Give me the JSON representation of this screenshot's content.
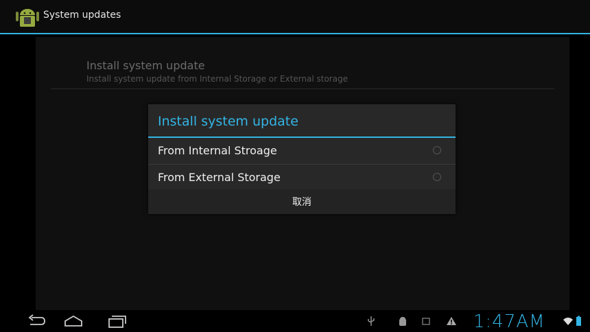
{
  "actionbar": {
    "title": "System updates",
    "icon": "android-app-icon"
  },
  "preference": {
    "title": "Install system update",
    "summary": "Install system update from Internal Storage or External storage"
  },
  "dialog": {
    "title": "Install system update",
    "options": [
      {
        "label": "From Internal Stroage",
        "selected": false
      },
      {
        "label": "From External Storage",
        "selected": false
      }
    ],
    "cancel_label": "取消"
  },
  "navbar": {
    "buttons": [
      "back-icon",
      "home-icon",
      "recent-apps-icon"
    ],
    "status_icons": [
      "usb-icon",
      "debug-icon",
      "sd-card-icon",
      "warning-icon"
    ],
    "time": "1:47AM",
    "wifi": "wifi-icon",
    "battery": "battery-icon"
  },
  "colors": {
    "accent": "#33b5e5",
    "background": "#000000",
    "dialog": "#282828"
  }
}
